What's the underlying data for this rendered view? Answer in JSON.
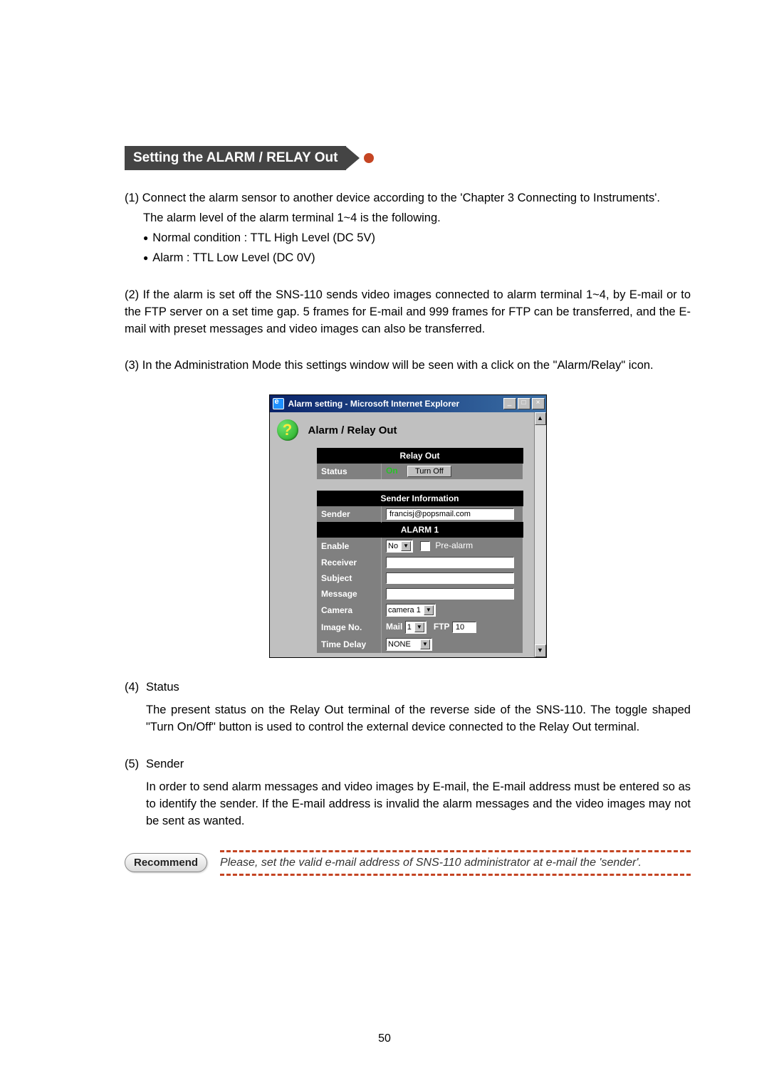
{
  "section_title": "Setting the ALARM / RELAY Out",
  "paras": {
    "p1_l1": "(1)  Connect the alarm sensor to another device according to the 'Chapter 3  Connecting to Instruments'.",
    "p1_l2": "The alarm  level of the alarm terminal 1~4 is the following.",
    "p1_b1": "Normal condition : TTL High Level (DC 5V)",
    "p1_b2": "Alarm : TTL Low Level (DC 0V)",
    "p2": "(2)  If the alarm is set off the SNS-110 sends video images connected to alarm terminal 1~4, by E-mail or to the FTP server on a set time gap. 5 frames for E-mail and 999 frames for FTP can be transferred, and the E-mail with preset messages and video images can also be transferred.",
    "p3": "(3)  In the Administration Mode this settings window will be seen with a click on the \"Alarm/Relay\" icon.",
    "p4_num": "(4)",
    "p4_title": "Status",
    "p4_body": "The present status on the Relay Out terminal of the reverse side of the SNS-110. The toggle shaped \"Turn On/Off\" button is used to control the external device connected to the Relay Out terminal.",
    "p5_num": "(5)",
    "p5_title": "Sender",
    "p5_body": "In order to send alarm messages and video images by E-mail, the E-mail address must be entered so as to identify the sender. If the E-mail address is invalid the alarm messages and the video images may not be sent as wanted."
  },
  "window": {
    "title": "Alarm setting - Microsoft Internet Explorer",
    "panel_title": "Alarm / Relay Out",
    "help_glyph": "?",
    "headers": {
      "relay_out": "Relay Out",
      "sender_info": "Sender Information",
      "alarm1": "ALARM 1"
    },
    "labels": {
      "status": "Status",
      "sender": "Sender",
      "enable": "Enable",
      "receiver": "Receiver",
      "subject": "Subject",
      "message": "Message",
      "camera": "Camera",
      "image_no": "Image No.",
      "time_delay": "Time Delay",
      "mail": "Mail",
      "ftp": "FTP",
      "prealarm": "Pre-alarm"
    },
    "values": {
      "status_on": "On",
      "turn_off_btn": "Turn Off",
      "sender_email": "francisj@popsmail.com",
      "enable_sel": "No",
      "camera_sel": "camera 1",
      "mail_sel": "1",
      "ftp_val": "10",
      "time_delay_sel": "NONE"
    },
    "winbtn": {
      "min": "_",
      "max": "□",
      "close": "×"
    },
    "scroll": {
      "up": "▲",
      "down": "▼"
    },
    "dropdown_arrow": "▼"
  },
  "recommend": {
    "badge": "Recommend",
    "text": "Please, set the valid e-mail address of SNS-110 administrator at  e-mail the 'sender'."
  },
  "page_number": "50"
}
